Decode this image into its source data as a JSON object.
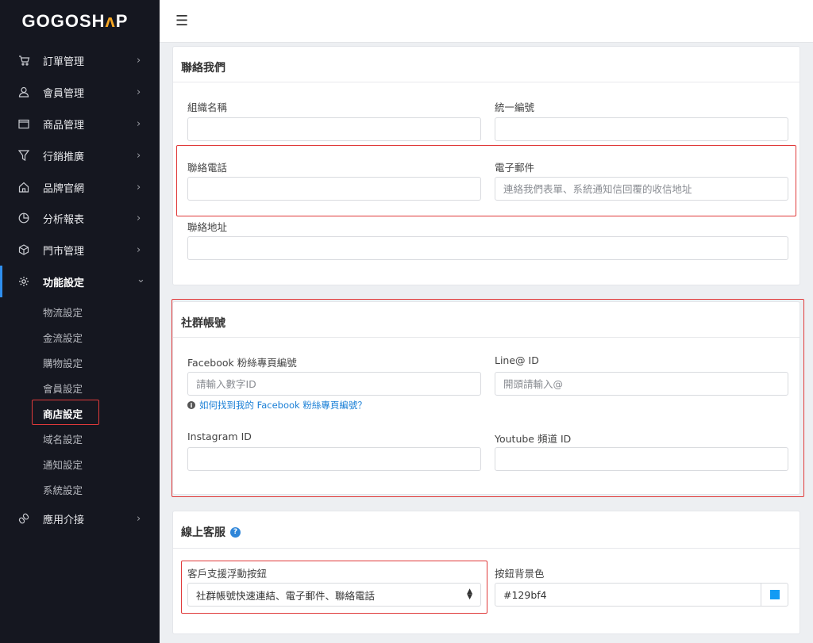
{
  "brand": {
    "logo_white": "GOGOSH",
    "logo_accent": "ʌ",
    "logo_end": "P"
  },
  "sidebar": {
    "items": [
      {
        "label": "訂單管理",
        "icon": "cart-icon",
        "chevron": "›"
      },
      {
        "label": "會員管理",
        "icon": "user-icon",
        "chevron": "›"
      },
      {
        "label": "商品管理",
        "icon": "box-window-icon",
        "chevron": "›"
      },
      {
        "label": "行銷推廣",
        "icon": "funnel-icon",
        "chevron": "›"
      },
      {
        "label": "品牌官網",
        "icon": "home-icon",
        "chevron": "›"
      },
      {
        "label": "分析報表",
        "icon": "pie-chart-icon",
        "chevron": "›"
      },
      {
        "label": "門市管理",
        "icon": "cube-icon",
        "chevron": "›"
      },
      {
        "label": "功能設定",
        "icon": "gear-icon",
        "chevron": "⌄"
      },
      {
        "label": "應用介接",
        "icon": "link-icon",
        "chevron": "›"
      }
    ],
    "subitems": [
      "物流設定",
      "金流設定",
      "購物設定",
      "會員設定",
      "商店設定",
      "域名設定",
      "通知設定",
      "系統設定"
    ]
  },
  "topbar": {
    "menu_icon": "☰"
  },
  "contact": {
    "title": "聯絡我們",
    "org_label": "組織名稱",
    "org_value": "",
    "taxid_label": "統一編號",
    "taxid_value": "",
    "phone_label": "聯絡電話",
    "phone_value": "",
    "email_label": "電子郵件",
    "email_value": "連絡我們表單、系統通知信回覆的收信地址",
    "address_label": "聯絡地址",
    "address_value": ""
  },
  "social": {
    "title": "社群帳號",
    "facebook_label": "Facebook 粉絲專頁編號",
    "facebook_placeholder": "請輸入數字ID",
    "facebook_help": "如何找到我的 Facebook 粉絲專頁編號？",
    "line_label": "Line@ ID",
    "line_placeholder": "開頭請輸入@",
    "instagram_label": "Instagram ID",
    "instagram_value": "",
    "youtube_label": "Youtube 頻道 ID",
    "youtube_value": ""
  },
  "support": {
    "title": "線上客服",
    "float_label": "客戶支援浮動按鈕",
    "float_value": "社群帳號快速連結、電子郵件、聯絡電話",
    "bg_label": "按鈕背景色",
    "bg_value": "#129bf4"
  },
  "colors": {
    "sidebar_bg": "#151720",
    "accent_blue": "#129bf4",
    "highlight_red": "#e03a3a",
    "logo_orange": "#f5a623"
  }
}
